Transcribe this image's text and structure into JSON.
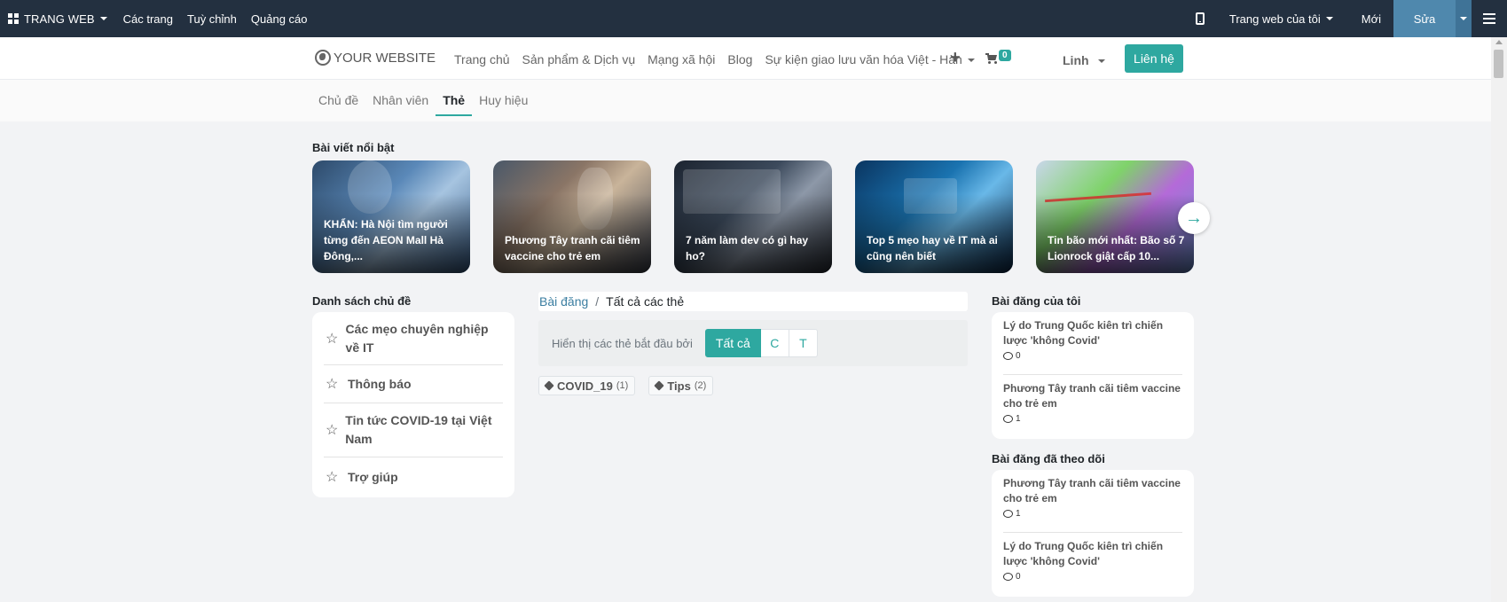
{
  "admin_bar": {
    "brand": "TRANG WEB",
    "links": [
      "Các trang",
      "Tuỳ chỉnh",
      "Quảng cáo"
    ],
    "site_selector": "Trang web của tôi",
    "new_label": "Mới",
    "edit_label": "Sửa",
    "colors": {
      "background": "#233040",
      "edit": "#4f88ad"
    }
  },
  "header": {
    "logo": "YOUR WEBSITE",
    "nav": [
      "Trang chủ",
      "Sản phẩm & Dịch vụ",
      "Mạng xã hội",
      "Blog",
      "Sự kiện giao lưu văn hóa Việt - Hàn"
    ],
    "cart_count": "0",
    "user": "Linh",
    "contact": "Liên hệ",
    "accent": "#2ea8a0"
  },
  "subnav": {
    "tabs": [
      "Chủ đề",
      "Nhân viên",
      "Thẻ",
      "Huy hiệu"
    ],
    "active": "Thẻ"
  },
  "featured": {
    "title": "Bài viết nổi bật",
    "cards": [
      "KHẨN: Hà Nội tìm người từng đến AEON Mall Hà Đông,...",
      "Phương Tây tranh cãi tiêm vaccine cho trẻ em",
      "7 năm làm dev có gì hay ho?",
      "Top 5 mẹo hay về IT mà ai cũng nên biết",
      "Tin bão mới nhất: Bão số 7 Lionrock giật cấp 10..."
    ],
    "next_icon": "arrow-right-icon"
  },
  "topics": {
    "title": "Danh sách chủ đề",
    "items": [
      "Các mẹo chuyên nghiệp về IT",
      "Thông báo",
      "Tin tức COVID-19 tại Việt Nam",
      "Trợ giúp"
    ]
  },
  "breadcrumb": {
    "link": "Bài đăng",
    "current": "Tất cả các thẻ"
  },
  "filter": {
    "label": "Hiển thị các thẻ bắt đầu bởi",
    "buttons": [
      "Tất cả",
      "C",
      "T"
    ]
  },
  "tags": [
    {
      "name": "COVID_19",
      "count": "(1)"
    },
    {
      "name": "Tips",
      "count": "(2)"
    }
  ],
  "my_posts": {
    "title": "Bài đăng của tôi",
    "items": [
      {
        "title": "Lý do Trung Quốc kiên trì chiến lược 'không Covid'",
        "comments": "0"
      },
      {
        "title": "Phương Tây tranh cãi tiêm vaccine cho trẻ em",
        "comments": "1"
      }
    ]
  },
  "followed_posts": {
    "title": "Bài đăng đã theo dõi",
    "items": [
      {
        "title": "Phương Tây tranh cãi tiêm vaccine cho trẻ em",
        "comments": "1"
      },
      {
        "title": "Lý do Trung Quốc kiên trì chiến lược 'không Covid'",
        "comments": "0"
      }
    ]
  }
}
